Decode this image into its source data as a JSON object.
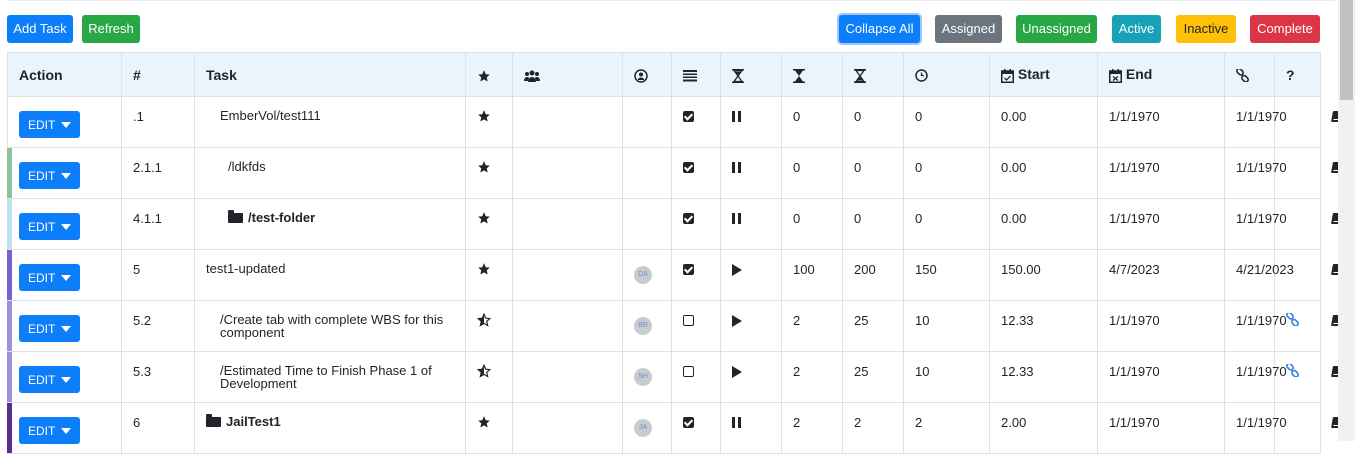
{
  "toolbar": {
    "add_task": "Add Task",
    "refresh": "Refresh",
    "collapse_all": "Collapse All",
    "assigned": "Assigned",
    "unassigned": "Unassigned",
    "active": "Active",
    "inactive": "Inactive",
    "complete": "Complete"
  },
  "colors": {
    "primary": "#0d7ef9",
    "success": "#28a745",
    "secondary": "#6c757d",
    "info": "#17a2b8",
    "warning": "#ffc107",
    "danger": "#dc3545",
    "header_bg": "#eaf4fd"
  },
  "table": {
    "headers": {
      "action": "Action",
      "number": "#",
      "task": "Task",
      "start": "Start",
      "end": "End",
      "help": "?"
    },
    "header_icons": [
      "star-icon",
      "users-icon",
      "user-circle-icon",
      "status-icon",
      "hourglass-start-icon",
      "hourglass-half-icon",
      "hourglass-end-icon",
      "clock-icon",
      "calendar-check-icon",
      "calendar-times-icon",
      "link-icon"
    ],
    "edit_label": "EDIT",
    "rows": [
      {
        "num": ".1",
        "task": "EmberVol/test111",
        "star": "full",
        "avatar": "",
        "checked": true,
        "state": "pause",
        "h1": "0",
        "h2": "0",
        "h3": "0",
        "time": "0.00",
        "start": "1/1/1970",
        "end": "1/1/1970",
        "link": false,
        "stripe": "",
        "bold": false,
        "folder": false
      },
      {
        "num": "2.1.1",
        "task": "/ldkfds",
        "star": "full",
        "avatar": "",
        "checked": true,
        "state": "pause",
        "h1": "0",
        "h2": "0",
        "h3": "0",
        "time": "0.00",
        "start": "1/1/1970",
        "end": "1/1/1970",
        "link": false,
        "stripe": "#8fc49b",
        "bold": false,
        "folder": false
      },
      {
        "num": "4.1.1",
        "task": "/test-folder",
        "star": "full",
        "avatar": "",
        "checked": true,
        "state": "pause",
        "h1": "0",
        "h2": "0",
        "h3": "0",
        "time": "0.00",
        "start": "1/1/1970",
        "end": "1/1/1970",
        "link": false,
        "stripe": "#bfe0ef",
        "bold": true,
        "folder": true
      },
      {
        "num": "5",
        "task": "test1-updated",
        "star": "full",
        "avatar": "DA",
        "checked": true,
        "state": "play",
        "h1": "100",
        "h2": "200",
        "h3": "150",
        "time": "150.00",
        "start": "4/7/2023",
        "end": "4/21/2023",
        "link": false,
        "stripe": "#7a5fd0",
        "bold": false,
        "folder": false
      },
      {
        "num": "5.2",
        "task": "/Create tab with complete WBS for this component",
        "star": "half",
        "avatar": "BR",
        "checked": false,
        "state": "play",
        "h1": "2",
        "h2": "25",
        "h3": "10",
        "time": "12.33",
        "start": "1/1/1970",
        "end": "1/1/1970",
        "link": true,
        "stripe": "#a090e0",
        "bold": false,
        "folder": false
      },
      {
        "num": "5.3",
        "task": "/Estimated Time to Finish Phase 1 of Development",
        "star": "half",
        "avatar": "SH",
        "checked": false,
        "state": "play",
        "h1": "2",
        "h2": "25",
        "h3": "10",
        "time": "12.33",
        "start": "1/1/1970",
        "end": "1/1/1970",
        "link": true,
        "stripe": "#a090e0",
        "bold": false,
        "folder": false
      },
      {
        "num": "6",
        "task": "JailTest1",
        "star": "full",
        "avatar": "JA",
        "checked": true,
        "state": "pause",
        "h1": "2",
        "h2": "2",
        "h3": "2",
        "time": "2.00",
        "start": "1/1/1970",
        "end": "1/1/1970",
        "link": false,
        "stripe": "#5a2d8c",
        "bold": true,
        "folder": true
      }
    ]
  }
}
